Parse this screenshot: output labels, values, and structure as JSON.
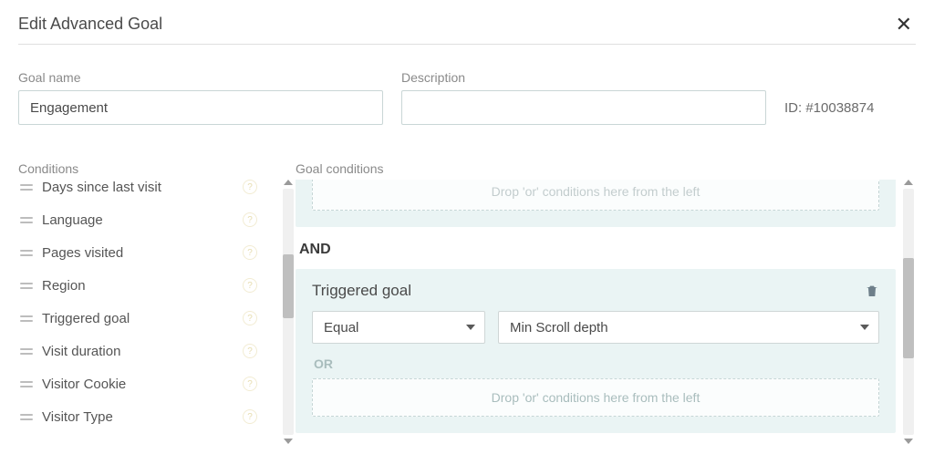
{
  "header": {
    "title": "Edit Advanced Goal"
  },
  "fields": {
    "goal_name_label": "Goal name",
    "goal_name_value": "Engagement",
    "description_label": "Description",
    "description_value": "",
    "id_label": "ID: #10038874"
  },
  "sections": {
    "conditions_label": "Conditions",
    "goal_conditions_label": "Goal conditions"
  },
  "conditions": [
    {
      "label": "Days since last visit"
    },
    {
      "label": "Language"
    },
    {
      "label": "Pages visited"
    },
    {
      "label": "Region"
    },
    {
      "label": "Triggered goal"
    },
    {
      "label": "Visit duration"
    },
    {
      "label": "Visitor Cookie"
    },
    {
      "label": "Visitor Type"
    }
  ],
  "goal_builder": {
    "top_drop_hint_faded": "Drop 'or' conditions here from the left",
    "connector": "AND",
    "block": {
      "title": "Triggered goal",
      "operator": "Equal",
      "value": "Min Scroll depth"
    },
    "or_label": "OR",
    "or_drop_hint": "Drop 'or' conditions here from the left"
  }
}
